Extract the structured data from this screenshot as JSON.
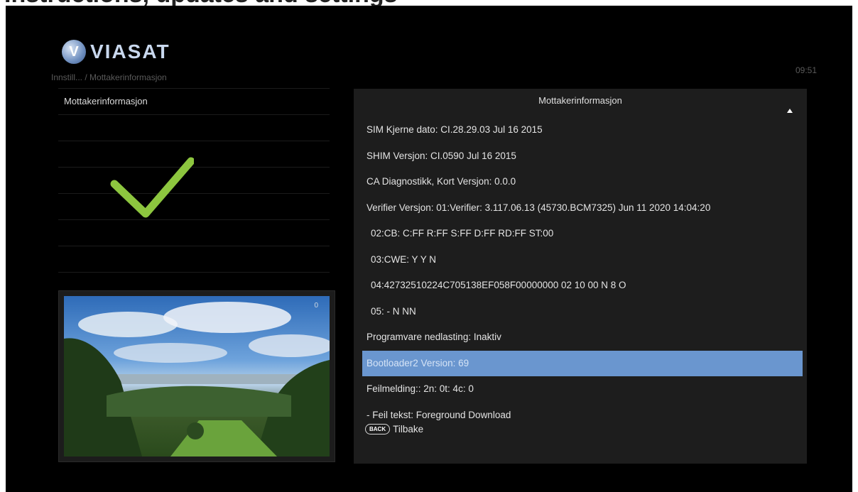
{
  "brand": {
    "name": "VIASAT"
  },
  "breadcrumb": "Innstill...  / Mottakerinformasjon",
  "clock": "09:51",
  "menu": {
    "items": [
      {
        "label": "Mottakerinformasjon"
      }
    ]
  },
  "panel": {
    "title": "Mottakerinformasjon",
    "rows": [
      {
        "text": "SIM Kjerne dato: CI.28.29.03 Jul 16 2015"
      },
      {
        "text": "SHIM Versjon: CI.0590 Jul 16 2015"
      },
      {
        "text": "CA Diagnostikk, Kort Versjon: 0.0.0"
      },
      {
        "text": "Verifier Versjon:  01:Verifier: 3.117.06.13 (45730.BCM7325) Jun 11 2020 14:04:20"
      },
      {
        "text": "02:CB: C:FF R:FF S:FF D:FF RD:FF ST:00"
      },
      {
        "text": "03:CWE: Y Y N"
      },
      {
        "text": "04:42732510224C705138EF058F00000000 02 10 00 N 8 O"
      },
      {
        "text": "05: - N NN"
      },
      {
        "text": "Programvare nedlasting: Inaktiv"
      },
      {
        "text": "Bootloader2 Version: 69"
      },
      {
        "text": "Feilmelding:: 2n:  0t:  4c:  0"
      },
      {
        "text": "- Feil tekst: Foreground Download"
      }
    ],
    "selected_index": 9,
    "back": {
      "key": "BACK",
      "label": "Tilbake"
    }
  },
  "preview": {
    "hud": "0"
  },
  "colors": {
    "selected": "#6a96cf",
    "checkmark": "#8dc63f",
    "panel": "#1d1d1d"
  }
}
